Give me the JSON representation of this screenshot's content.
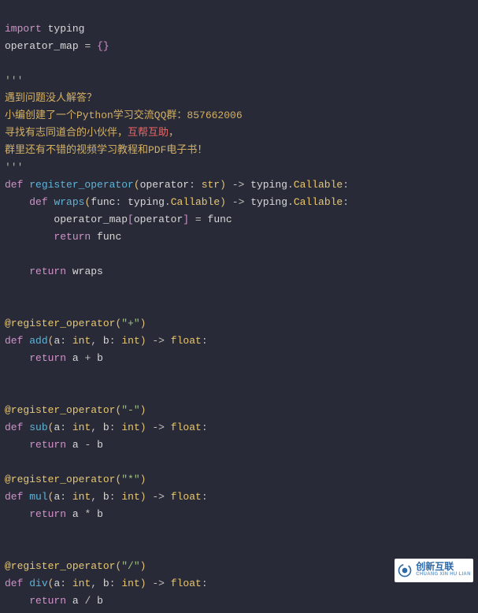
{
  "l1": {
    "import": "import",
    "typing": "typing"
  },
  "l2": {
    "name": "operator_map",
    "eq": "=",
    "br": "{}"
  },
  "doc": {
    "open": "'''",
    "l1a": "遇到问题没人解答？",
    "l2a": "小编创建了一个Python学习交流QQ群：857662006",
    "l3a": "寻找有志同道合的小伙伴，",
    "l3b": "互帮互助",
    "l3c": "，",
    "l4a": "群里还有不错的视频学习教程和PDF电子书！",
    "close": "'''"
  },
  "reg": {
    "def": "def",
    "name": "register_operator",
    "op": "operator",
    "str": "str",
    "arrow": "->",
    "typing": "typing",
    "callable": "Callable",
    "wraps": "wraps",
    "func": "func",
    "map": "operator_map",
    "eq": "=",
    "ret": "return"
  },
  "deco_name": "@register_operator",
  "add": {
    "op": "\"+\"",
    "name": "add",
    "a": "a",
    "b": "b",
    "int": "int",
    "float": "float",
    "ret": "return",
    "sign": "+"
  },
  "sub": {
    "op": "\"-\"",
    "name": "sub",
    "a": "a",
    "b": "b",
    "int": "int",
    "float": "float",
    "ret": "return",
    "sign": "-"
  },
  "mul": {
    "op": "\"*\"",
    "name": "mul",
    "a": "a",
    "b": "b",
    "int": "int",
    "float": "float",
    "ret": "return",
    "sign": "*"
  },
  "div": {
    "op": "\"/\"",
    "name": "div",
    "a": "a",
    "b": "b",
    "int": "int",
    "float": "float",
    "ret": "return",
    "sign": "/"
  },
  "watermark": {
    "brand": "创新互联",
    "sub": "CHUANG XIN HU LIAN"
  }
}
